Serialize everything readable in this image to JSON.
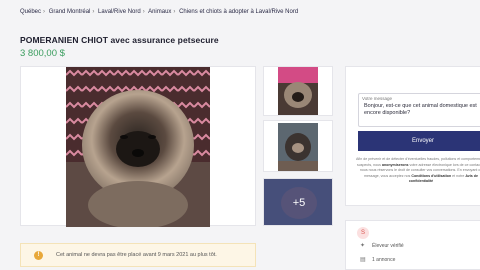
{
  "breadcrumb": [
    "Québec",
    "Grand Montréal",
    "Laval/Rive Nord",
    "Animaux",
    "Chiens et chiots à adopter à Laval/Rive Nord"
  ],
  "listing": {
    "title": "POMERANIEN CHIOT avec assurance petsecure",
    "price": "3 800,00 $"
  },
  "gallery": {
    "more_count": "+5"
  },
  "message": {
    "label": "Votre message",
    "text": "Bonjour, est-ce que cet animal domestique est encore disponible?",
    "send_label": "Envoyer",
    "fine_print_1": "Afin de prévenir et de détecter d'éventuelles fraudes, pollutions et comportements suspects, nous",
    "fine_print_2": "anonymiserons",
    "fine_print_3": "votre adresse électronique lors de ce contact et nous nous réservons le droit de consulter vos conversations. En envoyant ce message, vous acceptez nos",
    "terms_link": "Conditions d'utilisation",
    "fine_print_and": "et notre",
    "privacy_link": "Avis de confidentialité"
  },
  "notice": {
    "icon": "!",
    "text": "Cet animal ne devra pas être placé avant 9 mars 2021 au plus tôt."
  },
  "seller": {
    "avatar_letter": "S",
    "verified_label": "Éleveur vérifié",
    "listings_label": "1 annonce"
  },
  "colors": {
    "accent": "#2b3476",
    "price": "#3a9d5e",
    "notice_icon": "#e8a83a"
  }
}
